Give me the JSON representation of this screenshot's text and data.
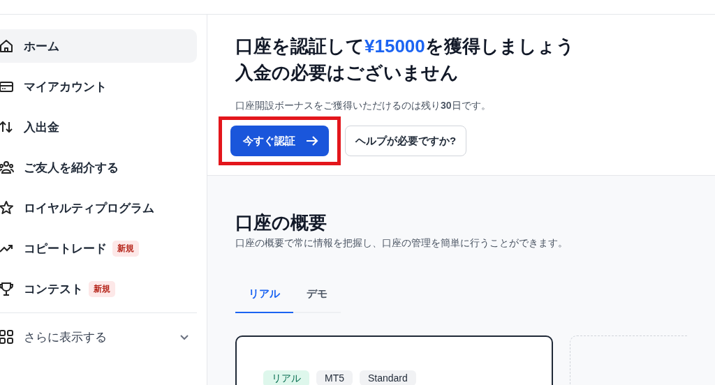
{
  "sidebar": {
    "items": [
      {
        "label": "ホーム",
        "kind": "house",
        "selected": true
      },
      {
        "label": "マイアカウント",
        "kind": "card",
        "selected": false
      },
      {
        "label": "入出金",
        "kind": "arrows",
        "selected": false
      },
      {
        "label": "ご友人を紹介する",
        "kind": "people",
        "selected": false
      },
      {
        "label": "ロイヤルティプログラム",
        "kind": "star",
        "selected": false
      },
      {
        "label": "コピートレード",
        "kind": "trend",
        "selected": false,
        "badge": "新規"
      },
      {
        "label": "コンテスト",
        "kind": "trophy",
        "selected": false,
        "badge": "新規"
      }
    ],
    "more": {
      "label": "さらに表示する",
      "expanded": false
    }
  },
  "promo": {
    "title_before": "口座を認証して",
    "title_amount": "¥15000",
    "title_after": "を獲得しましょう",
    "title_line2": "入金の必要はございません",
    "note": "口座開設ボーナスをご獲得いただけるのは残り**30**日です。",
    "verify_button": {
      "label": "今すぐ認証",
      "highlighted": true
    },
    "help_button": "ヘルプが必要ですか?"
  },
  "overview": {
    "title": "口座の概要",
    "subtitle": "口座の概要で常に情報を把握し、口座の管理を簡単に行うことができます。",
    "tabs": [
      {
        "label": "リアル",
        "selected": true
      },
      {
        "label": "デモ",
        "selected": false
      }
    ],
    "account_card": {
      "tags": [
        {
          "label": "リアル",
          "kind": "type"
        },
        {
          "label": "MT5",
          "kind": "plain"
        },
        {
          "label": "Standard",
          "kind": "plain"
        }
      ]
    }
  }
}
